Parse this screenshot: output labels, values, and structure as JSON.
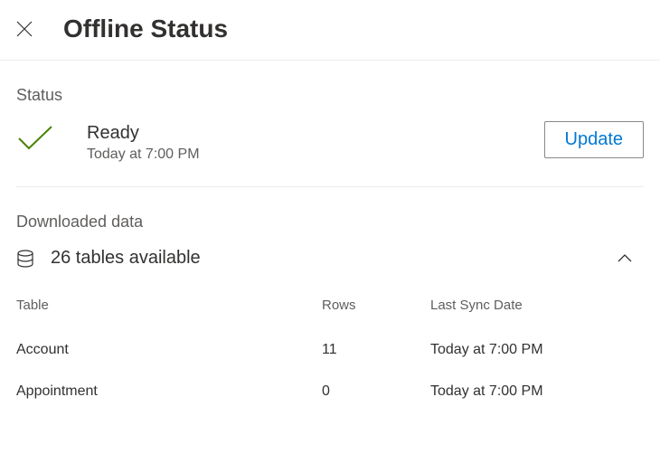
{
  "header": {
    "title": "Offline Status"
  },
  "status": {
    "section_label": "Status",
    "title": "Ready",
    "timestamp": "Today at 7:00 PM"
  },
  "actions": {
    "update_label": "Update"
  },
  "downloaded": {
    "section_label": "Downloaded data",
    "summary": "26 tables available"
  },
  "table": {
    "headers": {
      "table": "Table",
      "rows": "Rows",
      "last_sync": "Last Sync Date"
    },
    "rows": [
      {
        "name": "Account",
        "rows": "11",
        "last_sync": "Today at 7:00 PM"
      },
      {
        "name": "Appointment",
        "rows": "0",
        "last_sync": "Today at 7:00 PM"
      }
    ]
  },
  "colors": {
    "check_green": "#498205",
    "link_blue": "#0078d4",
    "text_primary": "#323130",
    "text_secondary": "#605e5c",
    "border": "#edebe9"
  }
}
